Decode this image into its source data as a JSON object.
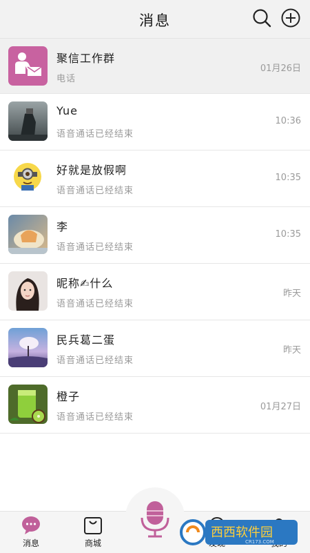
{
  "header": {
    "title": "消息",
    "search_icon": "search-icon",
    "add_icon": "plus-circle-icon"
  },
  "conversations": [
    {
      "name": "聚信工作群",
      "subtitle": "电话",
      "time": "01月26日",
      "avatar": "work-group-avatar",
      "pinned": true
    },
    {
      "name": "Yue",
      "subtitle": "语音通话已经结束",
      "time": "10:36",
      "avatar": "photo-avatar"
    },
    {
      "name": "好就是放假啊",
      "subtitle": "语音通话已经结束",
      "time": "10:35",
      "avatar": "minion-avatar"
    },
    {
      "name": "李",
      "subtitle": "语音通话已经结束",
      "time": "10:35",
      "avatar": "food-avatar"
    },
    {
      "name": "昵称✍什么",
      "subtitle": "语音通话已经结束",
      "time": "昨天",
      "avatar": "girl-avatar"
    },
    {
      "name": "民兵葛二蛋",
      "subtitle": "语音通话已经结束",
      "time": "昨天",
      "avatar": "landscape-avatar"
    },
    {
      "name": "橙子",
      "subtitle": "语音通话已经结束",
      "time": "01月27日",
      "avatar": "juice-avatar"
    }
  ],
  "tabbar": {
    "tabs": [
      {
        "label": "消息",
        "icon": "chat-bubble-icon"
      },
      {
        "label": "商城",
        "icon": "shopping-bag-icon"
      },
      {
        "label": "发现",
        "icon": "discover-icon"
      },
      {
        "label": "我的",
        "icon": "person-icon"
      }
    ],
    "center_icon": "microphone-icon"
  },
  "colors": {
    "accent": "#c0609a",
    "pinned_bg": "#f0f0f0",
    "subtle_text": "#9a9a9a"
  },
  "watermark": {
    "text": "西西软件园",
    "subtext": "CR173.COM"
  }
}
